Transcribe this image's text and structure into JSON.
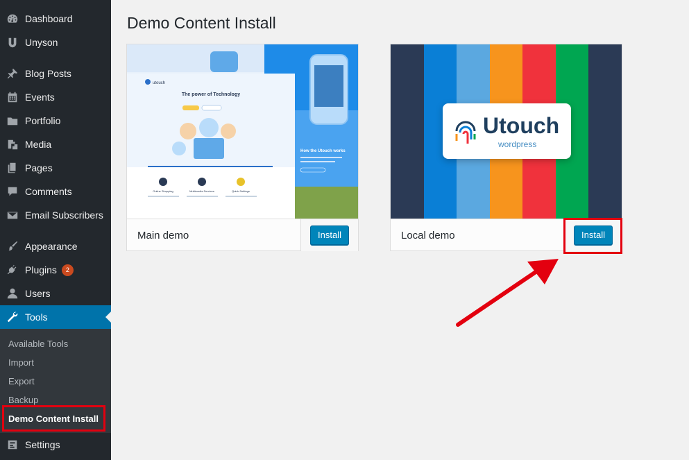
{
  "sidebar": {
    "items": [
      {
        "label": "Dashboard",
        "icon": "dashboard-icon"
      },
      {
        "label": "Unyson",
        "icon": "unyson-icon"
      },
      {
        "label": "Blog Posts",
        "icon": "pin-icon"
      },
      {
        "label": "Events",
        "icon": "calendar-icon"
      },
      {
        "label": "Portfolio",
        "icon": "folder-icon"
      },
      {
        "label": "Media",
        "icon": "media-icon"
      },
      {
        "label": "Pages",
        "icon": "pages-icon"
      },
      {
        "label": "Comments",
        "icon": "comment-icon"
      },
      {
        "label": "Email Subscribers",
        "icon": "email-icon"
      },
      {
        "label": "Appearance",
        "icon": "brush-icon"
      },
      {
        "label": "Plugins",
        "icon": "plugin-icon",
        "badge": "2"
      },
      {
        "label": "Users",
        "icon": "user-icon"
      },
      {
        "label": "Tools",
        "icon": "wrench-icon"
      },
      {
        "label": "Settings",
        "icon": "settings-icon"
      }
    ],
    "submenu": [
      "Available Tools",
      "Import",
      "Export",
      "Backup",
      "Demo Content Install"
    ]
  },
  "page": {
    "title": "Demo Content Install"
  },
  "demos": [
    {
      "name": "Main demo",
      "button": "Install"
    },
    {
      "name": "Local demo",
      "button": "Install"
    }
  ],
  "thumb_main": {
    "brand": "utouch",
    "heading": "The power of Technology",
    "works": "How the Utouch works",
    "features": [
      "Online Shopping",
      "Multimedia Services",
      "Quick Settings"
    ]
  },
  "thumb_local": {
    "logo": "Utouch",
    "logo_sub": "wordpress",
    "stripe_colors": [
      "#2b3a55",
      "#0a7fd6",
      "#5ba8e0",
      "#f7941d",
      "#f0323c",
      "#00a651",
      "#2b3a55"
    ]
  },
  "colors": {
    "admin_bar": "#23282d",
    "accent": "#0073aa",
    "button": "#0085ba",
    "highlight": "#e3000f"
  }
}
